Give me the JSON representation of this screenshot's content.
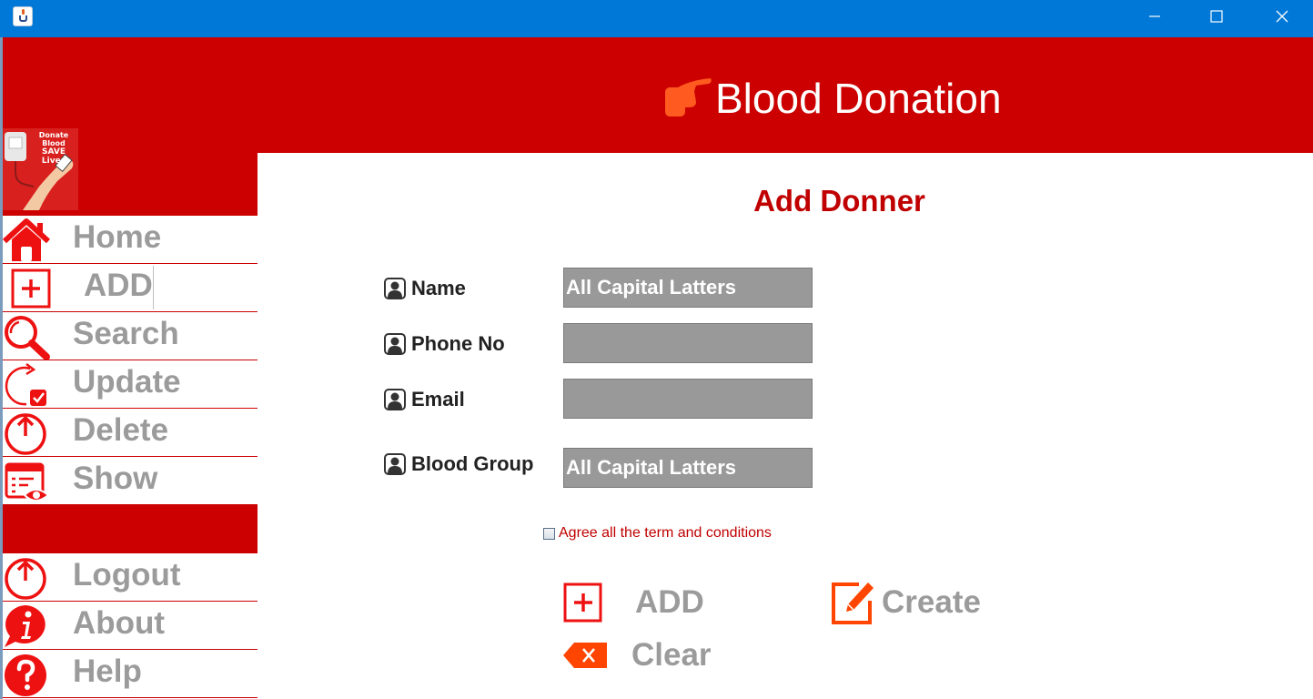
{
  "window": {
    "app_icon": "java-cup-icon",
    "controls": {
      "minimize": "minimize-icon",
      "maximize": "maximize-icon",
      "close": "close-icon"
    }
  },
  "header": {
    "title": "Blood Donation",
    "icon": "pointing-hand-blood-drop-icon"
  },
  "logo": {
    "text_line1": "Donate Blood",
    "text_line2": "SAVE Lives"
  },
  "sidebar": {
    "items": [
      {
        "label": "Home",
        "icon": "home-icon"
      },
      {
        "label": "ADD",
        "icon": "add-box-icon"
      },
      {
        "label": "Search",
        "icon": "magnifier-icon"
      },
      {
        "label": "Update",
        "icon": "refresh-check-icon"
      },
      {
        "label": "Delete",
        "icon": "power-icon"
      },
      {
        "label": "Show",
        "icon": "list-eye-icon"
      }
    ],
    "bottom_items": [
      {
        "label": "Logout",
        "icon": "power-icon"
      },
      {
        "label": "About",
        "icon": "info-icon"
      },
      {
        "label": "Help",
        "icon": "question-icon"
      }
    ]
  },
  "form": {
    "title": "Add Donner",
    "fields": [
      {
        "label": "Name",
        "value": "All Capital Latters"
      },
      {
        "label": "Phone No",
        "value": ""
      },
      {
        "label": "Email",
        "value": ""
      },
      {
        "label": "Blood Group",
        "value": "All Capital Latters"
      }
    ],
    "agree_label": "Agree all the term and conditions",
    "agree_checked": false,
    "buttons": {
      "add": "ADD",
      "clear": "Clear",
      "create": "Create"
    }
  },
  "colors": {
    "brand_red": "#cc0000",
    "title_bar_blue": "#0078d7",
    "label_gray": "#9b9b9b",
    "input_gray": "#999999",
    "accent_orange": "#ff4500"
  }
}
